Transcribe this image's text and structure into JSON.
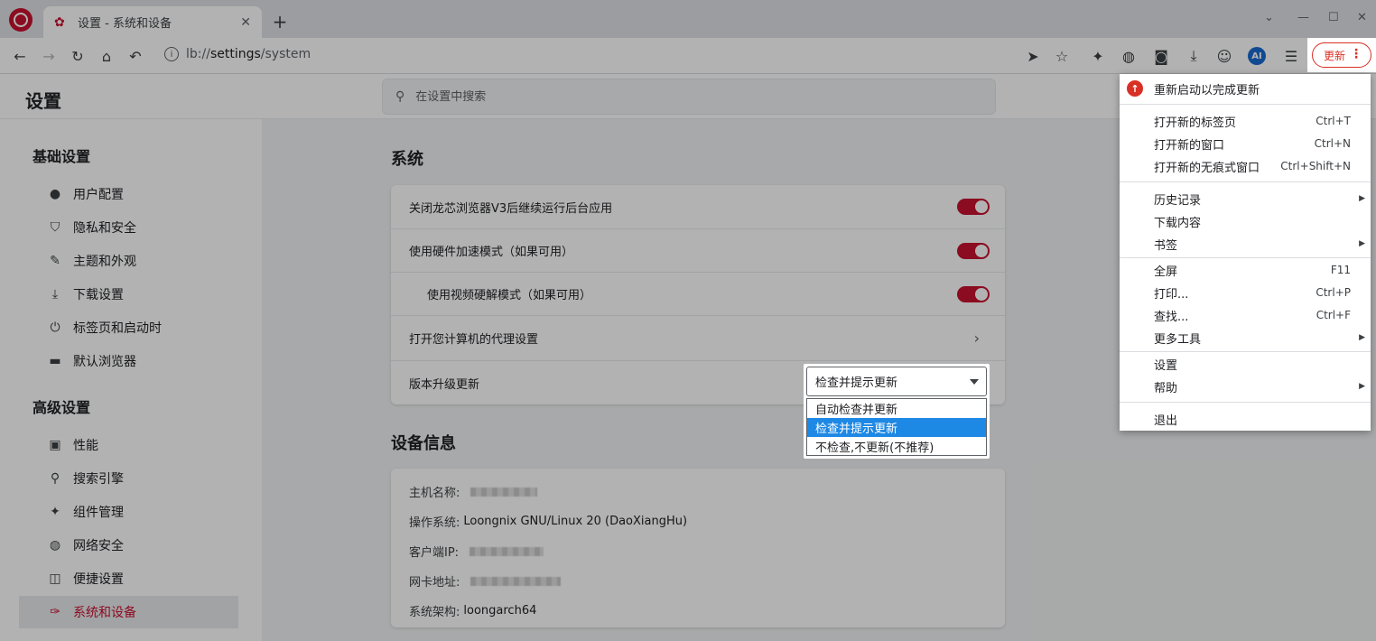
{
  "tab": {
    "title": "设置 - 系统和设备",
    "close": "✕"
  },
  "toolbar": {
    "url_prefix": "lb://",
    "url_host": "settings",
    "url_path": "/system",
    "update_label": "更新",
    "ai_label": "AI"
  },
  "page": {
    "title": "设置",
    "search_placeholder": "在设置中搜索"
  },
  "sidebar": {
    "basic_heading": "基础设置",
    "basic_items": [
      {
        "label": "用户配置",
        "icon": "person-icon"
      },
      {
        "label": "隐私和安全",
        "icon": "shield-icon"
      },
      {
        "label": "主题和外观",
        "icon": "palette-icon"
      },
      {
        "label": "下载设置",
        "icon": "download-icon"
      },
      {
        "label": "标签页和启动时",
        "icon": "power-icon"
      },
      {
        "label": "默认浏览器",
        "icon": "browser-icon"
      }
    ],
    "advanced_heading": "高级设置",
    "advanced_items": [
      {
        "label": "性能",
        "icon": "performance-icon"
      },
      {
        "label": "搜索引擎",
        "icon": "search-icon"
      },
      {
        "label": "组件管理",
        "icon": "puzzle-icon"
      },
      {
        "label": "网络安全",
        "icon": "globe-icon"
      },
      {
        "label": "便捷设置",
        "icon": "mouse-icon"
      },
      {
        "label": "系统和设备",
        "icon": "wrench-icon"
      }
    ]
  },
  "system": {
    "heading": "系统",
    "rows": [
      "关闭龙芯浏览器V3后继续运行后台应用",
      "使用硬件加速模式（如果可用）",
      "使用视频硬解模式（如果可用）",
      "打开您计算机的代理设置",
      "版本升级更新"
    ],
    "update_select": {
      "value": "检查并提示更新",
      "options": [
        "自动检查并更新",
        "检查并提示更新",
        "不检查,不更新(不推荐)"
      ]
    }
  },
  "device": {
    "heading": "设备信息",
    "host_label": "主机名称:",
    "os_label": "操作系统:",
    "os_value": "Loongnix GNU/Linux 20 (DaoXiangHu)",
    "ip_label": "客户端IP:",
    "mac_label": "网卡地址:",
    "arch_label": "系统架构:",
    "arch_value": "loongarch64"
  },
  "menu": {
    "restart": "重新启动以完成更新",
    "new_tab": "打开新的标签页",
    "new_tab_sc": "Ctrl+T",
    "new_window": "打开新的窗口",
    "new_window_sc": "Ctrl+N",
    "incognito": "打开新的无痕式窗口",
    "incognito_sc": "Ctrl+Shift+N",
    "history": "历史记录",
    "downloads": "下载内容",
    "bookmarks": "书签",
    "fullscreen": "全屏",
    "fullscreen_sc": "F11",
    "print": "打印...",
    "print_sc": "Ctrl+P",
    "find": "查找...",
    "find_sc": "Ctrl+F",
    "more_tools": "更多工具",
    "settings": "设置",
    "help": "帮助",
    "exit": "退出"
  }
}
